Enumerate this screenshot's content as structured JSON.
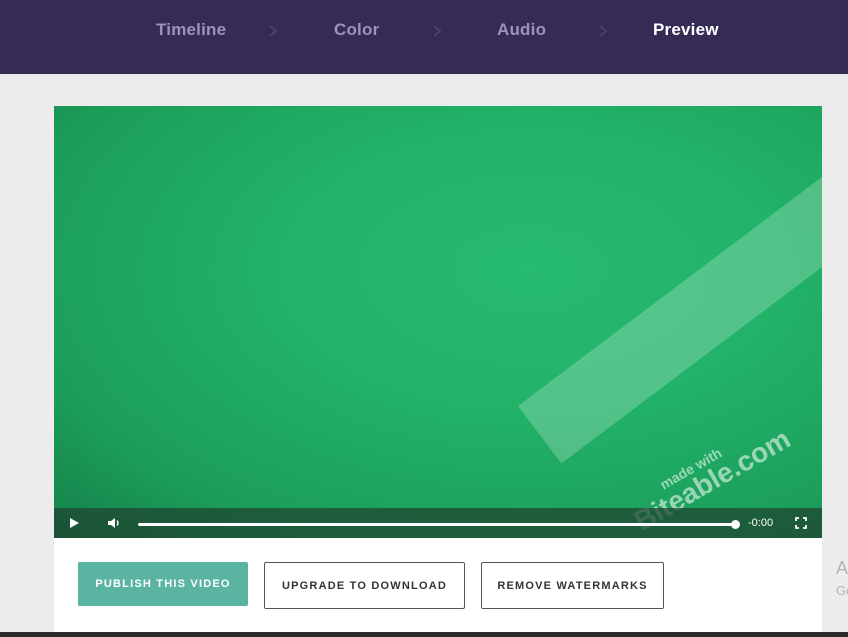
{
  "nav": {
    "steps": [
      {
        "label": "Timeline",
        "active": false
      },
      {
        "label": "Color",
        "active": false
      },
      {
        "label": "Audio",
        "active": false
      },
      {
        "label": "Preview",
        "active": true
      }
    ],
    "chevron_icon": "chevron-right-icon"
  },
  "video": {
    "background_color": "#22b369",
    "watermark": {
      "line1": "made with",
      "line2": "Biteable.com"
    },
    "controls": {
      "play_icon": "play-icon",
      "volume_icon": "volume-icon",
      "time_remaining": "-0:00",
      "fullscreen_icon": "fullscreen-icon",
      "progress": 1.0
    }
  },
  "actions": {
    "publish_label": "PUBLISH THIS VIDEO",
    "upgrade_label": "UPGRADE TO DOWNLOAD",
    "remove_label": "REMOVE WATERMARKS"
  },
  "edge": {
    "text1": "A",
    "text2": "Go"
  },
  "colors": {
    "topbar": "#352b55",
    "accent": "#5bb4a1",
    "page_bg": "#ececec"
  }
}
